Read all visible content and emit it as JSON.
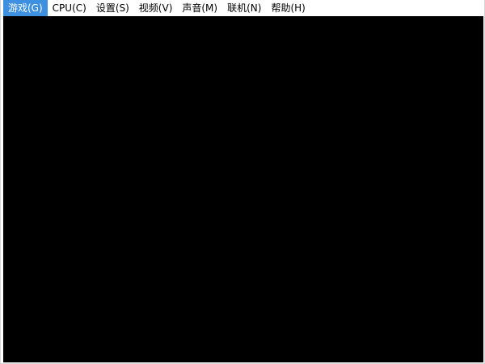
{
  "menubar": {
    "items": [
      {
        "label": "游戏(G)"
      },
      {
        "label": "CPU(C)"
      },
      {
        "label": "设置(S)"
      },
      {
        "label": "视频(V)"
      },
      {
        "label": "声音(M)"
      },
      {
        "label": "联机(N)"
      },
      {
        "label": "帮助(H)"
      }
    ],
    "active_index": 0
  },
  "colors": {
    "menu_highlight": "#3d8fe0",
    "viewport_background": "#000000",
    "menubar_background": "#ffffff"
  }
}
